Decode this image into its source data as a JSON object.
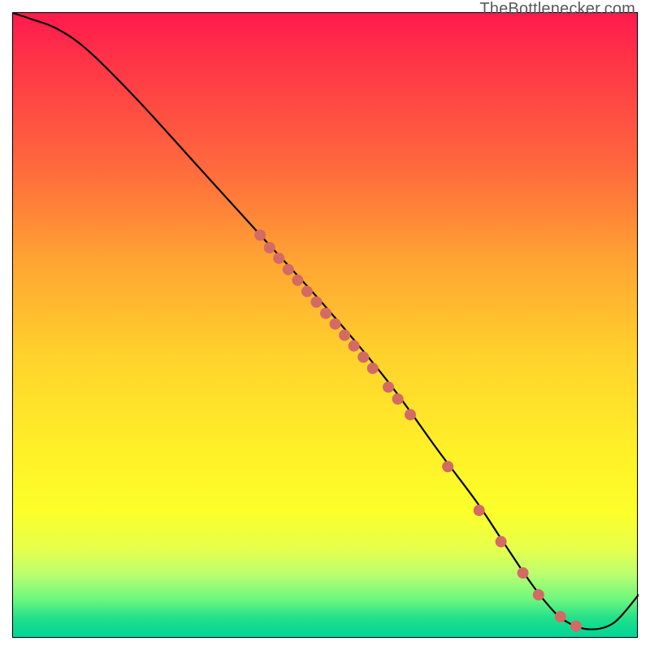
{
  "attribution": "TheBottlenecker.com",
  "chart_data": {
    "type": "line",
    "title": "",
    "xlabel": "",
    "ylabel": "",
    "xlim": [
      0,
      100
    ],
    "ylim": [
      0,
      100
    ],
    "background_gradient": {
      "top": "#ff1a4d",
      "mid_high": "#ffa532",
      "mid_low": "#fff028",
      "bottom": "#00d596"
    },
    "curve": {
      "name": "bottleneck-curve",
      "x": [
        0,
        3,
        7,
        12,
        20,
        30,
        40,
        50,
        60,
        68,
        74,
        78,
        82,
        85,
        88,
        92,
        96,
        100
      ],
      "y": [
        100,
        99,
        97.5,
        94,
        86,
        75,
        64,
        53,
        41,
        30,
        22,
        16,
        10,
        6,
        3,
        1.5,
        2.5,
        7
      ]
    },
    "markers": {
      "name": "sample-points",
      "color": "#d36a64",
      "radius": 7,
      "points": [
        {
          "x": 39.5,
          "y": 64.5
        },
        {
          "x": 41.0,
          "y": 62.5
        },
        {
          "x": 42.5,
          "y": 60.8
        },
        {
          "x": 44.0,
          "y": 59.0
        },
        {
          "x": 45.5,
          "y": 57.3
        },
        {
          "x": 47.0,
          "y": 55.5
        },
        {
          "x": 48.5,
          "y": 53.8
        },
        {
          "x": 50.0,
          "y": 52.0
        },
        {
          "x": 51.5,
          "y": 50.3
        },
        {
          "x": 53.0,
          "y": 48.5
        },
        {
          "x": 54.5,
          "y": 46.8
        },
        {
          "x": 56.0,
          "y": 45.0
        },
        {
          "x": 57.5,
          "y": 43.2
        },
        {
          "x": 60.0,
          "y": 40.2
        },
        {
          "x": 61.5,
          "y": 38.3
        },
        {
          "x": 63.5,
          "y": 35.8
        },
        {
          "x": 69.5,
          "y": 27.5
        },
        {
          "x": 74.5,
          "y": 20.5
        },
        {
          "x": 78.0,
          "y": 15.5
        },
        {
          "x": 81.5,
          "y": 10.5
        },
        {
          "x": 84.0,
          "y": 7.0
        },
        {
          "x": 87.5,
          "y": 3.5
        },
        {
          "x": 90.0,
          "y": 2.0
        }
      ]
    }
  }
}
